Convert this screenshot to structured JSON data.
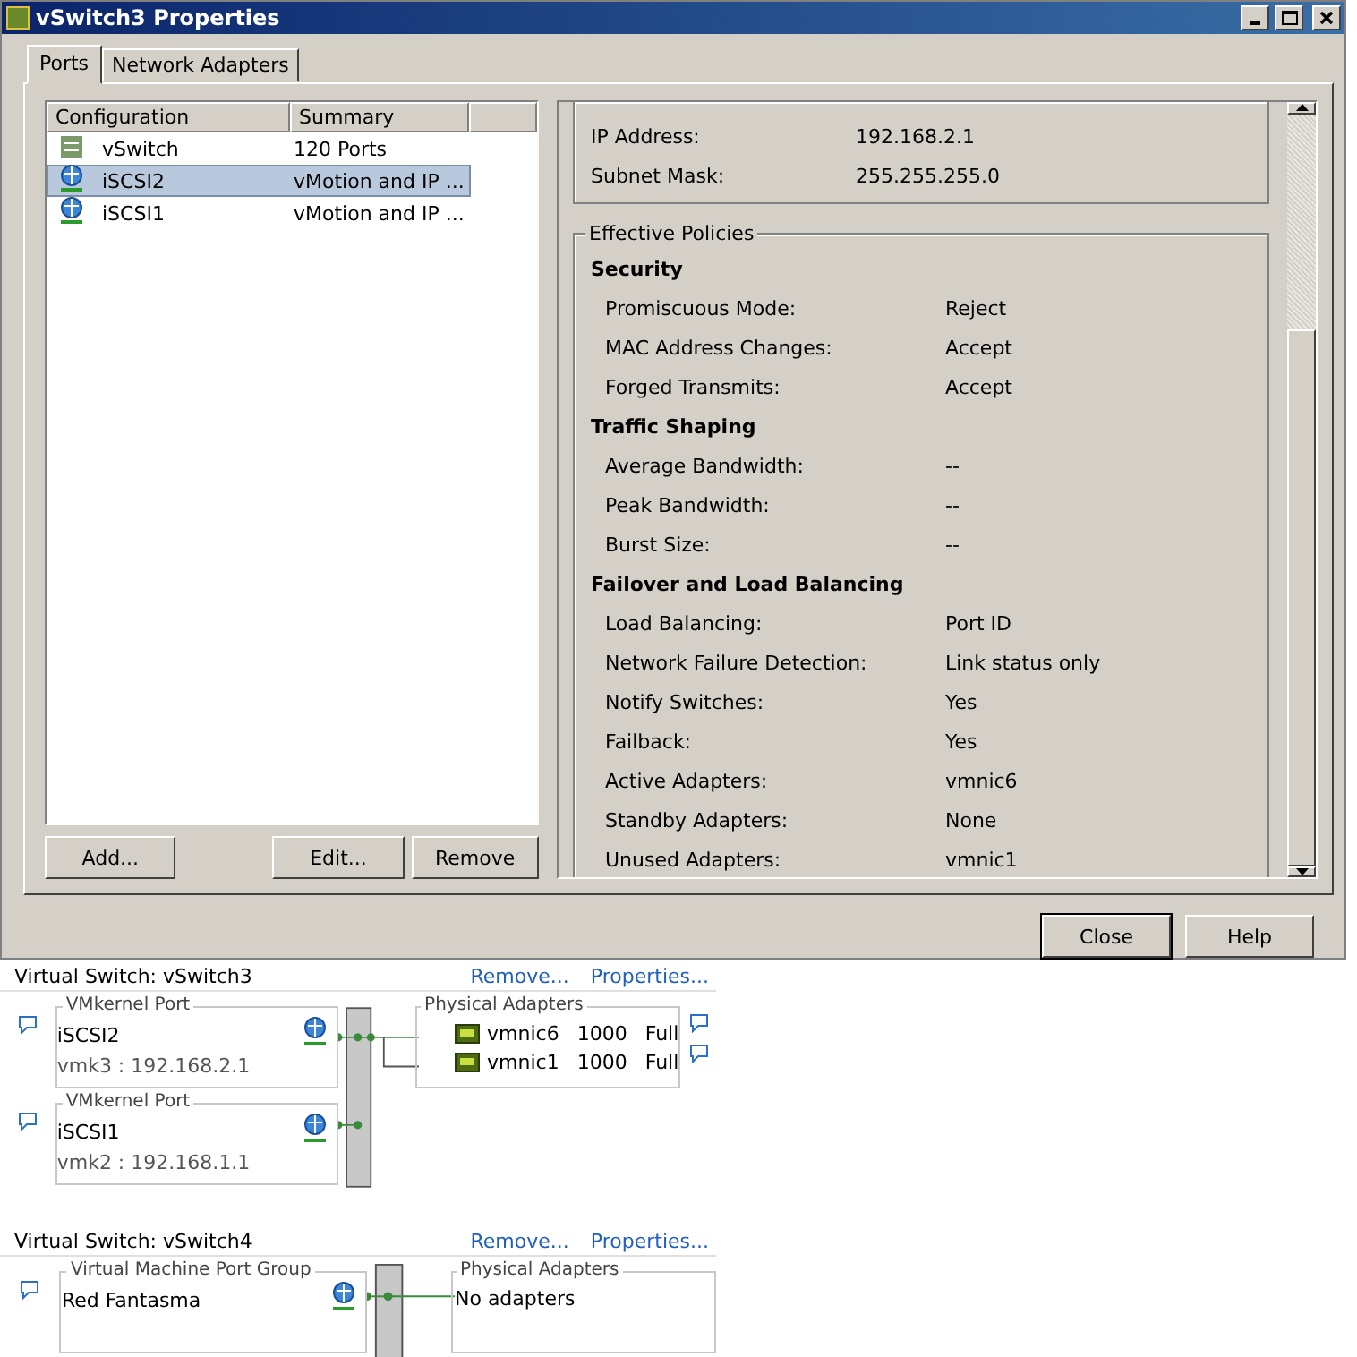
{
  "window": {
    "title": "vSwitch3 Properties"
  },
  "tabs": [
    {
      "label": "Ports",
      "selected": true
    },
    {
      "label": "Network Adapters",
      "selected": false
    }
  ],
  "ports_list": {
    "columns": [
      "Configuration",
      "Summary"
    ],
    "rows": [
      {
        "kind": "vswitch",
        "name": "vSwitch",
        "summary": "120 Ports",
        "selected": false
      },
      {
        "kind": "vmkernel",
        "name": "iSCSI2",
        "summary": "vMotion and IP ...",
        "selected": true
      },
      {
        "kind": "vmkernel",
        "name": "iSCSI1",
        "summary": "vMotion and IP ...",
        "selected": false
      }
    ]
  },
  "list_buttons": [
    "Add...",
    "Edit...",
    "Remove"
  ],
  "ip_settings": [
    {
      "label": "IP Address:",
      "value": "192.168.2.1"
    },
    {
      "label": "Subnet Mask:",
      "value": "255.255.255.0"
    }
  ],
  "effective_policies": {
    "title": "Effective Policies",
    "sections": [
      {
        "heading": "Security",
        "rows": [
          {
            "label": "Promiscuous Mode:",
            "value": "Reject"
          },
          {
            "label": "MAC Address Changes:",
            "value": "Accept"
          },
          {
            "label": "Forged Transmits:",
            "value": "Accept"
          }
        ]
      },
      {
        "heading": "Traffic Shaping",
        "rows": [
          {
            "label": "Average Bandwidth:",
            "value": "--"
          },
          {
            "label": "Peak Bandwidth:",
            "value": "--"
          },
          {
            "label": "Burst Size:",
            "value": "--"
          }
        ]
      },
      {
        "heading": "Failover and Load Balancing",
        "rows": [
          {
            "label": "Load Balancing:",
            "value": "Port ID"
          },
          {
            "label": "Network Failure Detection:",
            "value": "Link status only"
          },
          {
            "label": "Notify Switches:",
            "value": "Yes"
          },
          {
            "label": "Failback:",
            "value": "Yes"
          },
          {
            "label": "Active Adapters:",
            "value": "vmnic6"
          },
          {
            "label": "Standby Adapters:",
            "value": "None"
          },
          {
            "label": "Unused Adapters:",
            "value": "vmnic1"
          }
        ]
      }
    ]
  },
  "dialog_buttons": [
    {
      "label": "Close",
      "default": true
    },
    {
      "label": "Help",
      "default": false
    }
  ],
  "switches": [
    {
      "title": "Virtual Switch: vSwitch3",
      "links": [
        "Remove...",
        "Properties..."
      ],
      "port_groups": [
        {
          "heading": "VMkernel Port",
          "name": "iSCSI2",
          "detail": "vmk3 : 192.168.2.1"
        },
        {
          "heading": "VMkernel Port",
          "name": "iSCSI1",
          "detail": "vmk2 : 192.168.1.1"
        }
      ],
      "adapters_heading": "Physical Adapters",
      "adapters": [
        {
          "name": "vmnic6",
          "speed": "1000",
          "duplex": "Full"
        },
        {
          "name": "vmnic1",
          "speed": "1000",
          "duplex": "Full"
        }
      ]
    },
    {
      "title": "Virtual Switch: vSwitch4",
      "links": [
        "Remove...",
        "Properties..."
      ],
      "port_groups": [
        {
          "heading": "Virtual Machine Port Group",
          "name": "Red Fantasma"
        }
      ],
      "adapters_heading": "Physical Adapters",
      "no_adapters_text": "No adapters"
    }
  ]
}
